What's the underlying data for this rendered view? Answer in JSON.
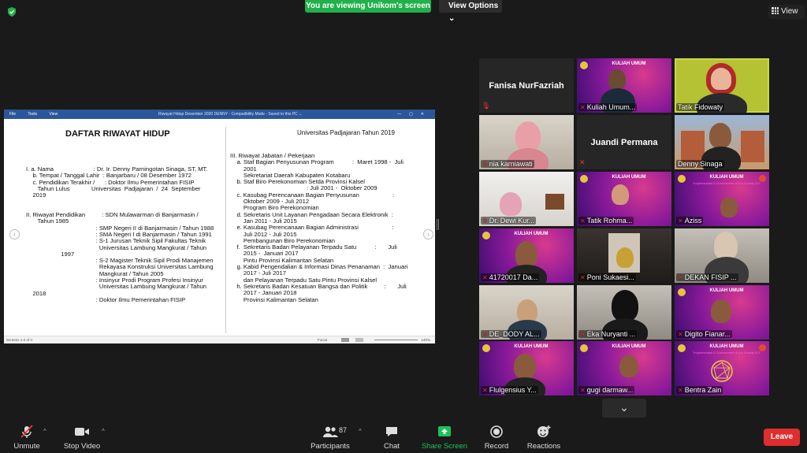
{
  "top": {
    "banner": "You are viewing Unikom's screen",
    "view_options": "View Options ⌄",
    "view": "View"
  },
  "word": {
    "menu": [
      "File",
      "Tools",
      "View"
    ],
    "title": "Riwayat Hidup Desember 2020 DENNY  -  Compatibility Mode  -  Saved to this PC ⌄",
    "status_left": "Screens 1-2 of 4",
    "status_right": "Focus",
    "zoom": "140%"
  },
  "doc": {
    "title": "DAFTAR RIWAYAT HIDUP",
    "left_text": "I. a. Nama                        : Dr. Ir. Denny Parningotan Sinaga, ST, MT.\n    b. Tempat / Tanggal Lahir  : Banjarbaru / 08 Desember 1972\n    c. Pendidikan Terakhir /      : Doktor Ilmu Pemerintahan FISIP\n       Tahun Lulus             Universitas  Padjajaran  /  24  September\n    2019\n\n\nII. Riwayat Pendidikan          : SDN Mulawarman di Banjarmasin /\n       Tahun 1985\n                                          : SMP Negeri II di Banjarmasin / Tahun 1988\n                                          : SMA Negeri I di Banjarmasin / Tahun 1991\n                                          : S-1 Jurusan Teknik Sipil Fakultas Teknik\n                                            Universitas Lambung Mangkurat / Tahun\n                     1997\n                                          : S-2 Magister Teknik Sipil Prodi Manajemen\n                                            Rekayasa Konstruksi Universitas Lambung\n                                            Mangkurat / Tahun 2005\n                                          : Insinyur Prodi Program Profesi Insinyur\n                                            Universitas Lambung Mangkurat / Tahun\n    2018\n                                          : Doktor Ilmu Pemerintahan FISIP",
    "right_top": "Universitas Padjajaran Tahun 2019",
    "right_text": "III. Riwayat Jabatan / Pekerjaan\n    a. Staf Bagian Penyusunan Program           :  Maret 1998 -  Juli\n        2001\n        Sekretariat Daerah Kabupaten Kotabaru\n    b. Staf Biro Perekonomian Setda Provinsi Kalsel\n                                              : Juli 2001 -  Oktober 2009\n    c. Kasubag Perencanaan Bagian Penyusunan                    :\n        Oktober 2009 - Juli 2012\n        Program Biro Perekonomian\n    d. Sekretaris Unit Layanan Pengadaan Secara Elektronik  :\n        Jan 2011 - Juli 2015\n    e. Kasubag Perencanaan Bagian Administrasi                    :\n        Juli 2012 - Juli 2015\n        Pembangunan Biro Perekonomian\n    f.  Sekretaris Badan Pelayanan Terpadu Satu           :       Juli\n        2015 -  Januari 2017\n        Pintu Provinsi Kalimantan Selatan\n    g. Kabid Pengendalian & Informasi Dinas Penanaman  :  Januari\n        2017 - Juli 2017\n        dan Pelayanan Terpadu Satu Pintu Provinsi Kalsel\n    h. Sekretaris Badan Kesatuan Bangsa dan Politik          :       Juli\n        2017 - Januari 2018\n        Provinsi Kalimantan Selatan"
  },
  "gallery": {
    "kuliah_title": "KULIAH UMUM",
    "kuliah_sub": "\"Implementasi E-Government di Era Society 5.0\"",
    "tiles": [
      {
        "name": "Fanisa NurFazriah",
        "type": "name"
      },
      {
        "name": "Kuliah Umum...",
        "type": "video"
      },
      {
        "name": "Tatik Fidowaty",
        "type": "video"
      },
      {
        "name": "nia karniawati",
        "type": "video"
      },
      {
        "name": "Juandi Permana",
        "type": "name"
      },
      {
        "name": "Denny Sinaga",
        "type": "video"
      },
      {
        "name": "Dr. Dewi Kur...",
        "type": "video"
      },
      {
        "name": "Tatik Rohma...",
        "type": "video"
      },
      {
        "name": "Aziss",
        "type": "video"
      },
      {
        "name": "41720017 Da...",
        "type": "video"
      },
      {
        "name": "Poni Sukaesi...",
        "type": "video"
      },
      {
        "name": "DEKAN FISIP ...",
        "type": "video"
      },
      {
        "name": "DE_DODY AL...",
        "type": "video"
      },
      {
        "name": "Eka Nuryanti ...",
        "type": "video"
      },
      {
        "name": "Digito Fianar...",
        "type": "video"
      },
      {
        "name": "Flulgensius Y...",
        "type": "video"
      },
      {
        "name": "gugi darmaw...",
        "type": "video"
      },
      {
        "name": "Bentra Zain",
        "type": "video"
      }
    ]
  },
  "toolbar": {
    "unmute": "Unmute",
    "stop_video": "Stop Video",
    "participants": "Participants",
    "participant_count": "87",
    "chat": "Chat",
    "share_screen": "Share Screen",
    "record": "Record",
    "reactions": "Reactions",
    "leave": "Leave"
  },
  "colors": {
    "banner_green": "#21b04b",
    "leave_red": "#e02d2d",
    "active_speaker": "#c8d84a",
    "word_blue": "#2b579a"
  }
}
